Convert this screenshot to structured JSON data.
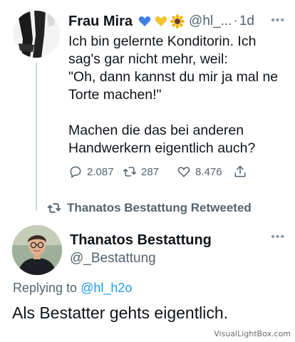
{
  "tweet": {
    "author_name": "Frau Mira",
    "author_emojis": [
      "blue-heart-icon",
      "yellow-heart-icon",
      "sunflower-icon"
    ],
    "handle": "@hl_...",
    "separator": "·",
    "time": "1d",
    "text": "Ich bin gelernte Konditorin. Ich sag's gar nicht mehr, weil:\n\"Oh, dann kannst du mir ja mal ne Torte machen!\"\n\nMachen die das bei anderen Handwerkern eigentlich auch?",
    "replies": "2.087",
    "retweets": "287",
    "likes": "8.476"
  },
  "retweet_banner": {
    "text": "Thanatos Bestattung Retweeted"
  },
  "reply": {
    "author_name": "Thanatos Bestattung",
    "handle": "@_Bestattung",
    "replying_prefix": "Replying to ",
    "replying_handle": "@hl_h2o",
    "text": "Als Bestatter gehts eigentlich."
  },
  "watermark": "VisualLightBox.com",
  "colors": {
    "text": "#0f1419",
    "secondary": "#536471",
    "link": "#1d9bf0",
    "thread_line": "#cfd9de"
  }
}
